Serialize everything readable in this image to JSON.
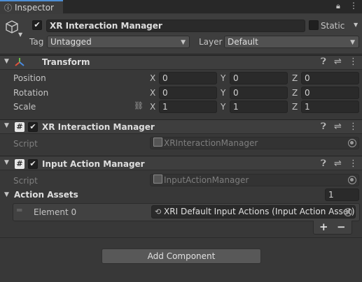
{
  "tab": {
    "title": "Inspector"
  },
  "gameobject": {
    "name": "XR Interaction Manager",
    "static_label": "Static",
    "tag_label": "Tag",
    "tag_value": "Untagged",
    "layer_label": "Layer",
    "layer_value": "Default"
  },
  "transform": {
    "title": "Transform",
    "rows": [
      {
        "label": "Position",
        "x": "0",
        "y": "0",
        "z": "0"
      },
      {
        "label": "Rotation",
        "x": "0",
        "y": "0",
        "z": "0"
      },
      {
        "label": "Scale",
        "x": "1",
        "y": "1",
        "z": "1"
      }
    ],
    "axis": {
      "x": "X",
      "y": "Y",
      "z": "Z"
    }
  },
  "xr_manager": {
    "title": "XR Interaction Manager",
    "script_label": "Script",
    "script_value": "XRInteractionManager"
  },
  "input_manager": {
    "title": "Input Action Manager",
    "script_label": "Script",
    "script_value": "InputActionManager",
    "assets_label": "Action Assets",
    "assets_count": "1",
    "element_label": "Element 0",
    "element_value": "XRI Default Input Actions (Input Action Asset)",
    "plus": "+",
    "minus": "−"
  },
  "add_component": "Add Component",
  "colors": {
    "background": "#383838",
    "header": "#3e3e3e",
    "field": "#2a2a2a",
    "tab": "#3c3c3c"
  },
  "icons": [
    "cube-icon",
    "lock-icon",
    "menu-icon",
    "help-icon",
    "preset-icon",
    "more-icon",
    "script-hash-icon",
    "object-picker-icon",
    "fold-arrow-icon",
    "reorder-handle-icon",
    "constrain-proportions-icon"
  ]
}
